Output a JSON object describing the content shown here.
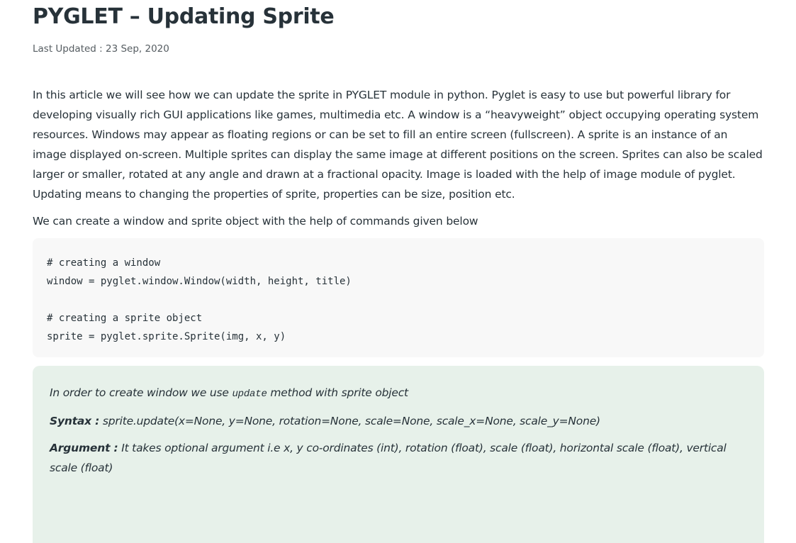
{
  "article": {
    "title": "PYGLET – Updating Sprite",
    "last_updated": "Last Updated : 23 Sep, 2020",
    "intro": "In this article we will see how we can update the sprite in PYGLET module in python. Pyglet is easy to use but powerful library for developing visually rich GUI applications like games, multimedia etc. A window is a “heavyweight” object occupying operating system resources. Windows may appear as floating regions or can be set to fill an entire screen (fullscreen). A sprite is an instance of an image displayed on-screen. Multiple sprites can display the same image at different positions on the screen. Sprites can also be scaled larger or smaller, rotated at any angle and drawn at a fractional opacity. Image is loaded with the help of image module of pyglet. Updating means to changing the properties of sprite, properties can be size, position etc.",
    "lead": "We can create a window and sprite object with the help of commands given below"
  },
  "code": {
    "line1": "# creating a window",
    "line2": "window = pyglet.window.Window(width, height, title)",
    "line3": "",
    "line4": "# creating a sprite object",
    "line5": "sprite = pyglet.sprite.Sprite(img, x, y)"
  },
  "note": {
    "line1_before": "In order to create window we use ",
    "line1_code": "update",
    "line1_after": " method with sprite object",
    "syntax_label": "Syntax :",
    "syntax_text": " sprite.update(x=None, y=None, rotation=None, scale=None, scale_x=None, scale_y=None)",
    "argument_label": "Argument :",
    "argument_text": " It takes optional argument i.e x, y co-ordinates (int), rotation (float), scale (float), horizontal scale (float), vertical scale (float)"
  }
}
